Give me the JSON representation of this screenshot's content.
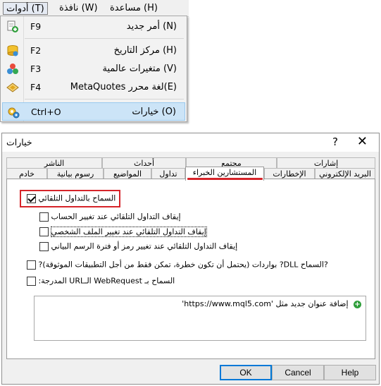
{
  "menubar": {
    "items": [
      {
        "label": "أدوات (T)"
      },
      {
        "label": "نافذة (W)"
      },
      {
        "label": "مساعدة (H)"
      }
    ]
  },
  "tools_menu": {
    "items": [
      {
        "label": "أمر جديد (N)",
        "shortcut": "F9",
        "icon": "new-order-icon"
      },
      {
        "label": "مركز التاريخ (H)",
        "shortcut": "F2",
        "icon": "history-center-icon"
      },
      {
        "label": "متغيرات عالمية (V)",
        "shortcut": "F3",
        "icon": "global-variables-icon"
      },
      {
        "label": "MetaQuotes لغة محرر(E)",
        "shortcut": "F4",
        "icon": "metaeditor-icon"
      },
      {
        "label": "خيارات (O)",
        "shortcut": "Ctrl+O",
        "icon": "options-icon"
      }
    ]
  },
  "dialog": {
    "title": "خيارات",
    "help_glyph": "?",
    "close_glyph": "✕",
    "tabs_row1": [
      "إشارات",
      "مجتمع",
      "أحداث",
      "الناشر"
    ],
    "tabs_row2": [
      "البريد الإلكتروني",
      "الإخطارات",
      "المستشارين الخبراء",
      "تداول",
      "المواضيع",
      "رسوم بيانية",
      "خادم"
    ],
    "selected_tab": "المستشارين الخبراء",
    "options": [
      {
        "label": "السماح بالتداول التلقائي",
        "checked": true
      },
      {
        "label": "إيقاف التداول التلقائي عند تغيير الحساب",
        "checked": false
      },
      {
        "label": "إيقاف التداول التلقائي عند تغيير الملف الشخصي",
        "checked": false
      },
      {
        "label": "إيقاف التداول التلقائي عند تغيير رمز أو فترة الرسم البياني",
        "checked": false
      },
      {
        "label": "?بواردات (يحتمل أن تكون خطرة، تمكن فقط من أجل التطبيقات الموثوقة) ?DLL السماح?",
        "checked": false
      },
      {
        "label": ":المدرجة URLالـ WebRequest السماح بـ",
        "checked": false
      }
    ],
    "url_entry": "'https://www.mql5.com' إضافة عنوان جديد مثل",
    "buttons": {
      "ok": "OK",
      "cancel": "Cancel",
      "help": "Help"
    }
  },
  "colors": {
    "highlight_red": "#d6242a",
    "menu_highlight": "#cce4f7",
    "accent_blue": "#0078d7"
  }
}
